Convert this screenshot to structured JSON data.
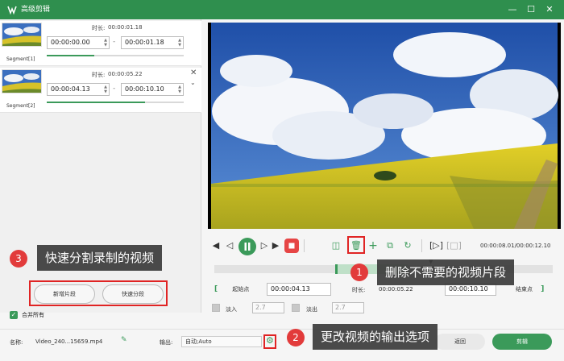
{
  "window": {
    "title": "高级剪辑"
  },
  "segments": [
    {
      "label": "Segment[1]",
      "duration_label": "时长:",
      "duration": "00:00:01.18",
      "start": "00:00:00.00",
      "end": "00:00:01.18",
      "progress": 0.35
    },
    {
      "label": "Segment[2]",
      "duration_label": "时长:",
      "duration": "00:00:05.22",
      "start": "00:00:04.13",
      "end": "00:00:10.10",
      "progress": 0.72
    }
  ],
  "left_buttons": {
    "new_segment": "新增片段",
    "quick_split": "快速分段"
  },
  "merge_all": "合并所有",
  "player": {
    "time_readout": "00:00:08.01/00:00:12.10"
  },
  "edit_row": {
    "start_point_label": "起始点",
    "start_time": "00:00:04.13",
    "duration_label": "时长:",
    "duration": "00:00:05.22",
    "end_time": "00:00:10.10",
    "end_point_label": "结束点"
  },
  "fade": {
    "fade_in_label": "淡入",
    "fade_in_value": "2.7",
    "fade_out_label": "淡出",
    "fade_out_value": "2.7"
  },
  "footer": {
    "name_label": "名称:",
    "file_name": "Video_240...15659.mp4",
    "output_label": "输出:",
    "output_value": "自动;Auto",
    "cancel_label": "返回",
    "edit_label": "剪辑"
  },
  "callouts": {
    "one": {
      "num": "1",
      "text": "删除不需要的视频片段"
    },
    "two": {
      "num": "2",
      "text": "更改视频的输出选项"
    },
    "three": {
      "num": "3",
      "text": "快速分割录制的视频"
    }
  },
  "colors": {
    "brand_green": "#2f8f4e",
    "accent_green": "#3b9a5a",
    "highlight_red": "#e02424",
    "stop_red": "#e64545"
  }
}
